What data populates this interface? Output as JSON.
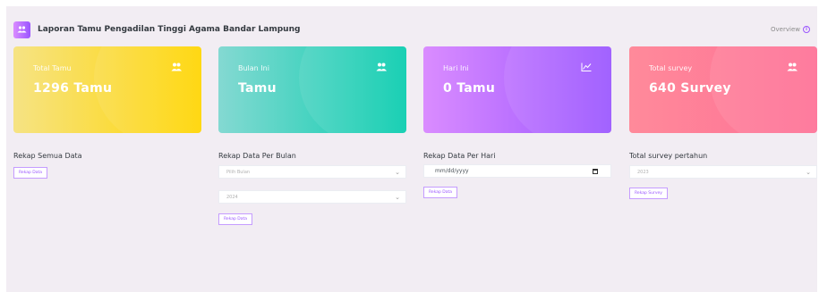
{
  "header": {
    "title": "Laporan Tamu Pengadilan Tinggi Agama Bandar Lampung",
    "title_icon": "users-icon",
    "overview": "Overview",
    "overview_icon": "info-circle-icon"
  },
  "cards": [
    {
      "label": "Total Tamu",
      "value": "1296 Tamu",
      "icon": "users-icon",
      "color": "#ffd500"
    },
    {
      "label": "Bulan Ini",
      "value": "Tamu",
      "icon": "users-icon",
      "color": "#07cdae"
    },
    {
      "label": "Hari Ini",
      "value": "0 Tamu",
      "icon": "chart-line-icon",
      "color": "#9a55ff"
    },
    {
      "label": "Total survey",
      "value": "640 Survey",
      "icon": "users-icon",
      "color": "#fe7096"
    }
  ],
  "sections": {
    "all": {
      "title": "Rekap Semua Data",
      "button": "Rekap Data"
    },
    "month": {
      "title": "Rekap Data Per Bulan",
      "month_select": "Pilih Bulan",
      "year_select": "2024",
      "button": "Rekap Data"
    },
    "day": {
      "title": "Rekap Data Per Hari",
      "date_placeholder": "mm/dd/yyyy",
      "button": "Rekap Data"
    },
    "survey": {
      "title": "Total survey pertahun",
      "year_select": "2023",
      "button": "Rekap Survey"
    }
  },
  "colors": {
    "accent": "#9a55ff",
    "background": "#f2edf3"
  }
}
